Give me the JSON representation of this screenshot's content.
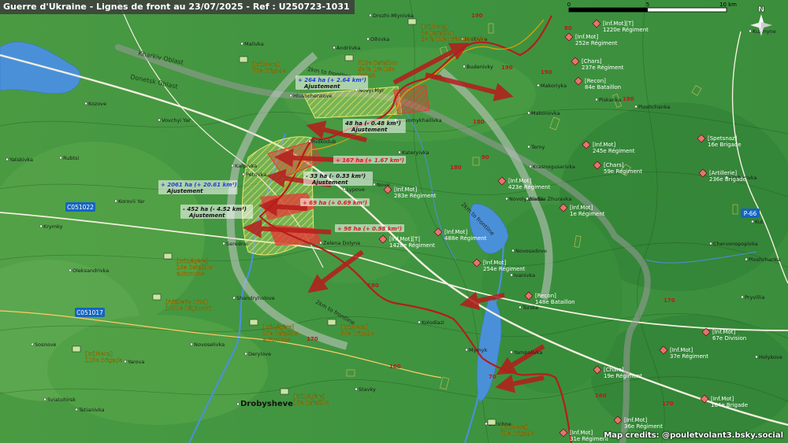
{
  "title": "Guerre d'Ukraine - Lignes de front au 23/07/2025 - Ref : U250723-1031",
  "credits": "Map credits: @pouletvolant3.bsky.social",
  "scalebar": {
    "ticks": [
      "0",
      "5",
      "10 km"
    ]
  },
  "compass": "N",
  "colors": {
    "ua": "#f0a500",
    "ru": "#c0392b",
    "front": "#b71c1c",
    "gain": "#e53935",
    "adjust": "#ffeb3b"
  },
  "regions": {
    "kharkiv": "Kharkiv Oblast",
    "donetsk": "Donetsk Oblast"
  },
  "roads": {
    "c051022": "C051022",
    "c051017": "C051017",
    "p66": "P-66"
  },
  "frontline_labels": {
    "a": "2km to frontline",
    "b": "2km to frontline",
    "c": "2km to frontline"
  },
  "road_numbers": [
    "190",
    "180",
    "180",
    "180",
    "190",
    "180",
    "170",
    "160",
    "170",
    "180",
    "160",
    "170",
    "70",
    "80",
    "90",
    "190"
  ],
  "towns": [
    {
      "name": "Drozhi-Mlynivka"
    },
    {
      "name": "Olhivka"
    },
    {
      "name": "Malivka"
    },
    {
      "name": "Andriivka"
    },
    {
      "name": "Hrekivka"
    },
    {
      "name": "Budenivky"
    },
    {
      "name": "Hlushchenkove"
    },
    {
      "name": "Novyi Myr"
    },
    {
      "name": "Novomykhailivka"
    },
    {
      "name": "Kozove"
    },
    {
      "name": "Vovchyi Yar"
    },
    {
      "name": "Rubtsi"
    },
    {
      "name": "Yatskivka"
    },
    {
      "name": "Karpivka"
    },
    {
      "name": "Petrivka"
    },
    {
      "name": "Ridkodub"
    },
    {
      "name": "Kateryivka"
    },
    {
      "name": "Lypove"
    },
    {
      "name": "Nove"
    },
    {
      "name": "Korovii Yar"
    },
    {
      "name": "Krymky"
    },
    {
      "name": "Seredne"
    },
    {
      "name": "Oleksandrivka"
    },
    {
      "name": "Zelena Dolyna"
    },
    {
      "name": "Shandryholove"
    },
    {
      "name": "Sosnove"
    },
    {
      "name": "Novoselivka"
    },
    {
      "name": "Derylove"
    },
    {
      "name": "Yarova"
    },
    {
      "name": "Sviatohirsk"
    },
    {
      "name": "Tetianivka"
    },
    {
      "name": "Drobysheve"
    },
    {
      "name": "Stavky"
    },
    {
      "name": "Kolodiazi"
    },
    {
      "name": "Zarichne"
    },
    {
      "name": "Yampolivka"
    },
    {
      "name": "Mymyk"
    },
    {
      "name": "Torske"
    },
    {
      "name": "Ivanivka"
    },
    {
      "name": "Novosadove"
    },
    {
      "name": "Novolyubivka"
    },
    {
      "name": "Nadiia Zhuravka"
    },
    {
      "name": "Krasnogusarivka"
    },
    {
      "name": "Terny"
    },
    {
      "name": "Makonovka"
    },
    {
      "name": "Makoriyka"
    },
    {
      "name": "Piskanka"
    },
    {
      "name": "Ploshchanka"
    },
    {
      "name": "Hryhorivka"
    },
    {
      "name": "Chervonopopivka"
    },
    {
      "name": "Ploshchanka"
    },
    {
      "name": "Kuzmyne"
    },
    {
      "name": "Kut"
    },
    {
      "name": "Holykove"
    },
    {
      "name": "Pryvillia"
    },
    {
      "name": "Zarichne"
    }
  ],
  "ua_units": [
    {
      "l1": "[Inf.Meca]",
      "l2": "66e Brigade",
      "l3": ""
    },
    {
      "l1": "[Inf.Meca]",
      "l2": "4e Bataillon",
      "l3": "de la Bde présidentielle"
    },
    {
      "l1": "518e Bataillon",
      "l2": "de la 1re Bde",
      "l3": "Bohun"
    },
    {
      "l1": "[Inf.Légère]",
      "l2": "19e Bataillon",
      "l3": "autonome"
    },
    {
      "l1": "[Artillerie SAM]",
      "l2": "1039e Régiment",
      "l3": ""
    },
    {
      "l1": "[Inf.Légère]",
      "l2": "35e Bataillon",
      "l3": "autonome"
    },
    {
      "l1": "[Inf.Meca]",
      "l2": "60e Brigade",
      "l3": ""
    },
    {
      "l1": "[Inf.Meca]",
      "l2": "115e Brigade",
      "l3": ""
    },
    {
      "l1": "[Inf.Légère]",
      "l2": "16e Bataillon",
      "l3": ""
    },
    {
      "l1": "[Inf.Meca]",
      "l2": "63e Brigade",
      "l3": ""
    }
  ],
  "ru_units": [
    {
      "l1": "[Inf.Mot][T]",
      "l2": "1220e Régiment"
    },
    {
      "l1": "[Inf.Mot]",
      "l2": "252e Régiment"
    },
    {
      "l1": "[Chars]",
      "l2": "237e Régiment"
    },
    {
      "l1": "[Recon]",
      "l2": "84e Bataillon"
    },
    {
      "l1": "[Inf.Mot]",
      "l2": "245e Régiment"
    },
    {
      "l1": "[Chars]",
      "l2": "59e Régiment"
    },
    {
      "l1": "[Spetsnaz]",
      "l2": "16e Brigade"
    },
    {
      "l1": "[Artillerie]",
      "l2": "236e Brigade"
    },
    {
      "l1": "[Inf.Mot]",
      "l2": "423e Régiment"
    },
    {
      "l1": "[Inf.Mot]",
      "l2": "1e Régiment"
    },
    {
      "l1": "[Inf.Mot]",
      "l2": "283e Régiment"
    },
    {
      "l1": "[Inf.Mot]",
      "l2": "488e Régiment"
    },
    {
      "l1": "[Inf.Mot][T]",
      "l2": "1428e Régiment"
    },
    {
      "l1": "[Inf.Mot]",
      "l2": "254e Régiment"
    },
    {
      "l1": "[Recon]",
      "l2": "148e Bataillon"
    },
    {
      "l1": "[Inf.Mot]",
      "l2": "67e Division"
    },
    {
      "l1": "[Inf.Mot]",
      "l2": "37e Régiment"
    },
    {
      "l1": "[Chars]",
      "l2": "19e Régiment"
    },
    {
      "l1": "[Inf.Mot]",
      "l2": "164e Brigade"
    },
    {
      "l1": "[Inf.Mot]",
      "l2": "36e Régiment"
    },
    {
      "l1": "[Inf.Mot]",
      "l2": "31e Régiment"
    }
  ],
  "changes": [
    {
      "l1": "+ 264 ha (+ 2.64 km²)",
      "l2": "Ajustement",
      "kind": "ua"
    },
    {
      "l1": "48 ha (- 0.48 km²)",
      "l2": "Ajustement",
      "kind": "dark"
    },
    {
      "l1": "+ 167 ha (+ 1.67 km²)",
      "l2": "",
      "kind": "ru"
    },
    {
      "l1": "+ 2061 ha (+ 20.61 km²)",
      "l2": "Ajustement",
      "kind": "ua"
    },
    {
      "l1": "- 33 ha (- 0.33 km²)",
      "l2": "Ajustement",
      "kind": "dark"
    },
    {
      "l1": "- 452 ha (- 4.52 km²)",
      "l2": "Ajustement",
      "kind": "dark"
    },
    {
      "l1": "+ 69 ha (+ 0.69 km²)",
      "l2": "",
      "kind": "ru"
    },
    {
      "l1": "+ 98 ha (+ 0.98 km²)",
      "l2": "",
      "kind": "ru"
    }
  ]
}
